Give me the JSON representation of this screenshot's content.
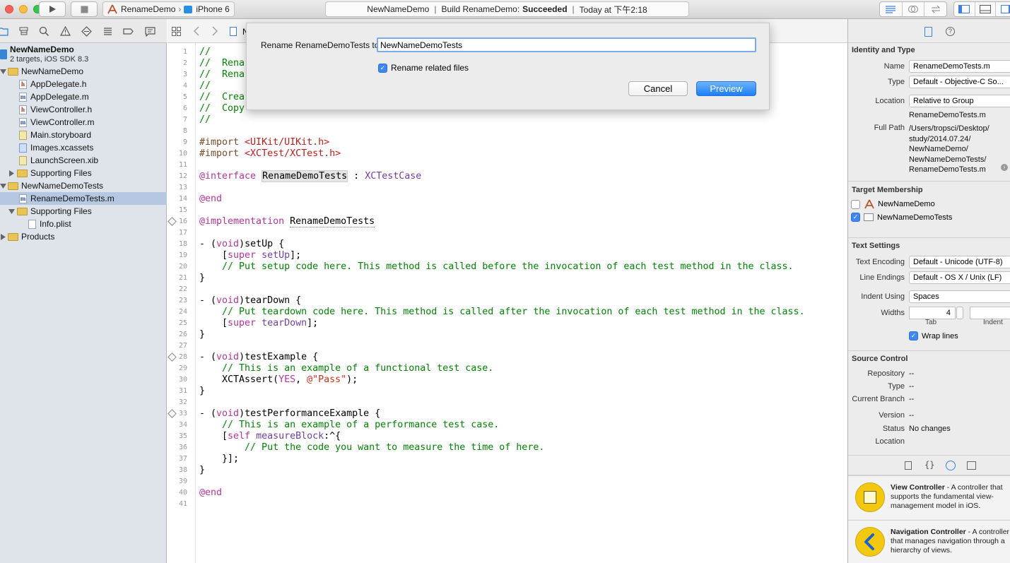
{
  "toolbar": {
    "scheme": "RenameDemo",
    "scheme_sep": "›",
    "device": "iPhone 6",
    "status_project": "NewNameDemo",
    "status_sep1": "|",
    "status_build_prefix": "Build RenameDemo:",
    "status_build_result": "Succeeded",
    "status_sep2": "|",
    "status_time": "Today at 下午2:18"
  },
  "navigator": {
    "project_name": "NewNameDemo",
    "project_subtitle": "2 targets, iOS SDK 8.3",
    "items": [
      {
        "label": "NewNameDemo",
        "icon": "folder-icon"
      },
      {
        "label": "AppDelegate.h",
        "icon": "header-file-icon",
        "badge": "h"
      },
      {
        "label": "AppDelegate.m",
        "icon": "objc-file-icon",
        "badge": "m"
      },
      {
        "label": "ViewController.h",
        "icon": "header-file-icon",
        "badge": "h"
      },
      {
        "label": "ViewController.m",
        "icon": "objc-file-icon",
        "badge": "m"
      },
      {
        "label": "Main.storyboard",
        "icon": "storyboard-icon"
      },
      {
        "label": "Images.xcassets",
        "icon": "asset-catalog-icon"
      },
      {
        "label": "LaunchScreen.xib",
        "icon": "xib-file-icon"
      },
      {
        "label": "Supporting Files",
        "icon": "folder-icon"
      },
      {
        "label": "NewNameDemoTests",
        "icon": "folder-icon"
      },
      {
        "label": "RenameDemoTests.m",
        "icon": "objc-file-icon",
        "badge": "m"
      },
      {
        "label": "Supporting Files",
        "icon": "folder-icon"
      },
      {
        "label": "Info.plist",
        "icon": "plist-file-icon"
      },
      {
        "label": "Products",
        "icon": "folder-icon"
      }
    ]
  },
  "jumpbar": {
    "crumb": "N"
  },
  "sheet": {
    "label": "Rename RenameDemoTests to",
    "input_value": "NewNameDemoTests",
    "checkbox_label": "Rename related files",
    "cancel": "Cancel",
    "preview": "Preview"
  },
  "code": {
    "lines": [
      "1",
      "2",
      "3",
      "4",
      "5",
      "6",
      "7",
      "8",
      "9",
      "10",
      "11",
      "12",
      "13",
      "14",
      "15",
      "16",
      "17",
      "18",
      "19",
      "20",
      "21",
      "22",
      "23",
      "24",
      "25",
      "26",
      "27",
      "28",
      "29",
      "30",
      "31",
      "32",
      "33",
      "34",
      "35",
      "36",
      "37",
      "38",
      "39",
      "40",
      "41"
    ],
    "l1": "//",
    "l2": "//  Rena",
    "l3": "//  Rena",
    "l4": "//",
    "l5": "//  Crea",
    "l6": "//  Copy",
    "l7": "//",
    "l9a": "#import ",
    "l9b": "<UIKit/UIKit.h>",
    "l10a": "#import ",
    "l10b": "<XCTest/XCTest.h>",
    "l12a": "@interface",
    "l12b": "RenameDemoTests",
    "l12c": " : ",
    "l12d": "XCTestCase",
    "l14": "@end",
    "l16a": "@implementation",
    "l16b": "RenameDemoTests",
    "l18a": "- (",
    "l18b": "void",
    "l18c": ")setUp {",
    "l19a": "    [",
    "l19b": "super",
    "l19c": " ",
    "l19d": "setUp",
    "l19e": "];",
    "l20": "    // Put setup code here. This method is called before the invocation of each test method in the class.",
    "l21": "}",
    "l23a": "- (",
    "l23b": "void",
    "l23c": ")tearDown {",
    "l24": "    // Put teardown code here. This method is called after the invocation of each test method in the class.",
    "l25a": "    [",
    "l25b": "super",
    "l25c": " ",
    "l25d": "tearDown",
    "l25e": "];",
    "l26": "}",
    "l28a": "- (",
    "l28b": "void",
    "l28c": ")testExample {",
    "l29": "    // This is an example of a functional test case.",
    "l30a": "    XCTAssert(",
    "l30b": "YES",
    "l30c": ", ",
    "l30d": "@\"Pass\"",
    "l30e": ");",
    "l31": "}",
    "l33a": "- (",
    "l33b": "void",
    "l33c": ")testPerformanceExample {",
    "l34": "    // This is an example of a performance test case.",
    "l35a": "    [",
    "l35b": "self",
    "l35c": " ",
    "l35d": "measureBlock",
    "l35e": ":^{",
    "l36": "        // Put the code you want to measure the time of here.",
    "l37": "    }];",
    "l38": "}",
    "l40": "@end"
  },
  "inspector": {
    "identity_header": "Identity and Type",
    "name_label": "Name",
    "name_value": "RenameDemoTests.m",
    "type_label": "Type",
    "type_value": "Default - Objective-C So...",
    "location_label": "Location",
    "location_value": "Relative to Group",
    "location_file": "RenameDemoTests.m",
    "fullpath_label": "Full Path",
    "fullpath_lines": [
      "/Users/tropsci/Desktop/",
      "study/2014.07.24/",
      "NewNameDemo/",
      "NewNameDemoTests/",
      "RenameDemoTests.m"
    ],
    "target_header": "Target Membership",
    "targets": [
      {
        "label": "NewNameDemo",
        "checked": false
      },
      {
        "label": "NewNameDemoTests",
        "checked": true
      }
    ],
    "text_header": "Text Settings",
    "encoding_label": "Text Encoding",
    "encoding_value": "Default - Unicode (UTF-8)",
    "endings_label": "Line Endings",
    "endings_value": "Default - OS X / Unix (LF)",
    "indent_label": "Indent Using",
    "indent_value": "Spaces",
    "widths_label": "Widths",
    "tab_value": "4",
    "tab_label": "Tab",
    "indent_width_label": "Indent",
    "wrap_label": "Wrap lines",
    "source_header": "Source Control",
    "repo_label": "Repository",
    "repo_value": "--",
    "sc_type_label": "Type",
    "sc_type_value": "--",
    "branch_label": "Current Branch",
    "branch_value": "--",
    "version_label": "Version",
    "version_value": "--",
    "status_label": "Status",
    "status_value": "No changes",
    "sc_location_label": "Location",
    "library": [
      {
        "title": "View Controller",
        "desc": " - A controller that supports the fundamental view-management model in iOS."
      },
      {
        "title": "Navigation Controller",
        "desc": " - A controller that manages navigation through a hierarchy of views."
      }
    ]
  },
  "colors": {
    "accent": "#3f88f4",
    "selection": "#b6c7e1",
    "comment": "#008400",
    "keyword": "#b8329d",
    "string": "#d12f1b"
  }
}
